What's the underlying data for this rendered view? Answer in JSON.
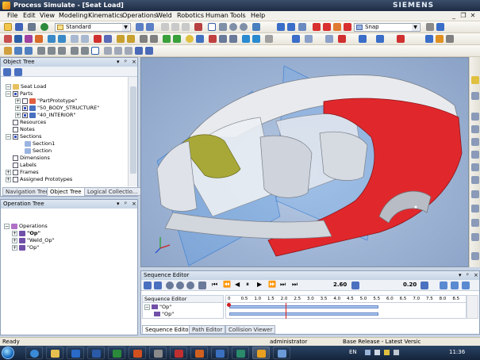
{
  "window": {
    "title": "Process Simulate - [Seat Load]",
    "brand": "SIEMENS"
  },
  "menu": [
    "File",
    "Edit",
    "View",
    "Modeling",
    "Kinematics",
    "Operations",
    "Weld",
    "Robotics",
    "Human",
    "Tools",
    "Help"
  ],
  "toolbar": {
    "layout_combo": "Standard",
    "snap_combo": "Snap"
  },
  "object_tree": {
    "title": "Object Tree",
    "items": [
      {
        "label": "Seat Load",
        "level": 0
      },
      {
        "label": "Parts",
        "level": 1
      },
      {
        "label": "\"PartPrototype\"",
        "level": 2
      },
      {
        "label": "\"50_BODY_STRUCTURE\"",
        "level": 2
      },
      {
        "label": "\"40_INTERIOR\"",
        "level": 2
      },
      {
        "label": "Resources",
        "level": 1
      },
      {
        "label": "Notes",
        "level": 1
      },
      {
        "label": "Sections",
        "level": 1
      },
      {
        "label": "Section1",
        "level": 2
      },
      {
        "label": "Section",
        "level": 2
      },
      {
        "label": "Dimensions",
        "level": 1
      },
      {
        "label": "Labels",
        "level": 1
      },
      {
        "label": "Frames",
        "level": 1
      },
      {
        "label": "Assigned Prototypes",
        "level": 1
      }
    ],
    "tabs": [
      "Navigation Tree",
      "Object Tree",
      "Logical Collectio..."
    ],
    "active_tab": 1
  },
  "operation_tree": {
    "title": "Operation Tree",
    "items": [
      {
        "label": "Operations",
        "level": 0
      },
      {
        "label": "\"Op\"",
        "level": 1
      },
      {
        "label": "\"Weld_Op\"",
        "level": 1
      },
      {
        "label": "\"Op\"",
        "level": 1
      }
    ]
  },
  "sequence_editor": {
    "title": "Sequence Editor",
    "time_value": "2.60",
    "step_value": "0.20",
    "column_header": "Sequence Editor",
    "rows": [
      "\"Op\"",
      "\"Op\""
    ],
    "ruler_ticks": [
      "0",
      "0.5",
      "1.0",
      "1.5",
      "2.0",
      "2.5",
      "3.0",
      "3.5",
      "4.0",
      "4.5",
      "5.0",
      "5.5",
      "6.0",
      "6.5",
      "7.0",
      "7.5",
      "8.0",
      "8.5"
    ],
    "tabs": [
      "Sequence Editor",
      "Path Editor",
      "Collision Viewer"
    ],
    "active_tab": 0
  },
  "status": {
    "left": "Ready",
    "user": "administrator",
    "version": "Base Release - Latest Versic"
  },
  "taskbar": {
    "language": "EN",
    "clock": "11:36"
  },
  "colors": {
    "body_red": "#e0282c",
    "seat_olive": "#a8a838",
    "section_plane": "#5a9ee8",
    "viewport_bg": "#9db3d4"
  }
}
